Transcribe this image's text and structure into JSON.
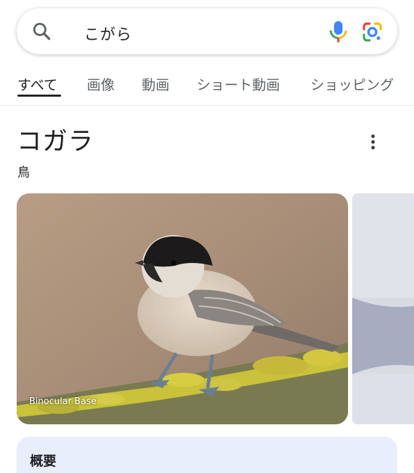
{
  "search": {
    "query": "こがら"
  },
  "tabs": [
    {
      "label": "すべて",
      "active": true
    },
    {
      "label": "画像",
      "active": false
    },
    {
      "label": "動画",
      "active": false
    },
    {
      "label": "ショート動画",
      "active": false
    },
    {
      "label": "ショッピング",
      "active": false
    }
  ],
  "entity": {
    "title": "コガラ",
    "subtitle": "鳥"
  },
  "images": [
    {
      "credit": "Binocular Base",
      "subject": "willow tit on lichen-covered branch"
    }
  ],
  "overview": {
    "title": "概要"
  },
  "colors": {
    "mic_blue": "#4285f4",
    "mic_red": "#ea4335",
    "mic_yellow": "#fbbc04",
    "mic_green": "#34a853",
    "overview_bg": "#e8eefb"
  },
  "icons": [
    "search-icon",
    "microphone-icon",
    "google-lens-icon",
    "more-vertical-icon"
  ]
}
